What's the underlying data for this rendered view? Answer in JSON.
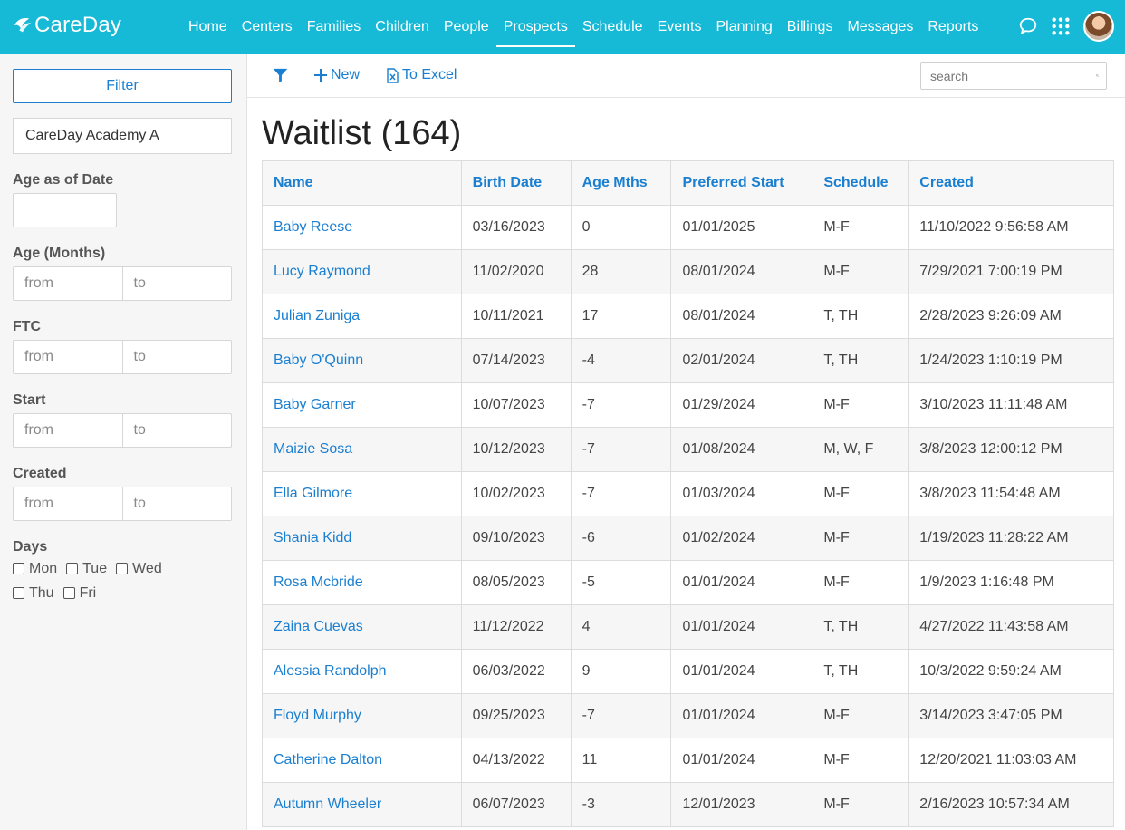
{
  "brand": "CareDay",
  "nav": [
    "Home",
    "Centers",
    "Families",
    "Children",
    "People",
    "Prospects",
    "Schedule",
    "Events",
    "Planning",
    "Billings",
    "Messages",
    "Reports"
  ],
  "nav_active": "Prospects",
  "sidebar": {
    "filter_label": "Filter",
    "center": "CareDay Academy A",
    "age_as_of_date_label": "Age as of Date",
    "age_months_label": "Age (Months)",
    "ftc_label": "FTC",
    "start_label": "Start",
    "created_label": "Created",
    "from_placeholder": "from",
    "to_placeholder": "to",
    "days_label": "Days",
    "days": [
      "Mon",
      "Tue",
      "Wed",
      "Thu",
      "Fri"
    ]
  },
  "toolbar": {
    "new_label": "New",
    "excel_label": "To Excel",
    "search_placeholder": "search"
  },
  "title": "Waitlist (164)",
  "table": {
    "headers": [
      "Name",
      "Birth Date",
      "Age Mths",
      "Preferred Start",
      "Schedule",
      "Created"
    ],
    "rows": [
      [
        "Baby Reese",
        "03/16/2023",
        "0",
        "01/01/2025",
        "M-F",
        "11/10/2022 9:56:58 AM"
      ],
      [
        "Lucy Raymond",
        "11/02/2020",
        "28",
        "08/01/2024",
        "M-F",
        "7/29/2021 7:00:19 PM"
      ],
      [
        "Julian Zuniga",
        "10/11/2021",
        "17",
        "08/01/2024",
        "T, TH",
        "2/28/2023 9:26:09 AM"
      ],
      [
        "Baby O'Quinn",
        "07/14/2023",
        "-4",
        "02/01/2024",
        "T, TH",
        "1/24/2023 1:10:19 PM"
      ],
      [
        "Baby Garner",
        "10/07/2023",
        "-7",
        "01/29/2024",
        "M-F",
        "3/10/2023 11:11:48 AM"
      ],
      [
        "Maizie Sosa",
        "10/12/2023",
        "-7",
        "01/08/2024",
        "M, W, F",
        "3/8/2023 12:00:12 PM"
      ],
      [
        "Ella Gilmore",
        "10/02/2023",
        "-7",
        "01/03/2024",
        "M-F",
        "3/8/2023 11:54:48 AM"
      ],
      [
        "Shania Kidd",
        "09/10/2023",
        "-6",
        "01/02/2024",
        "M-F",
        "1/19/2023 11:28:22 AM"
      ],
      [
        "Rosa Mcbride",
        "08/05/2023",
        "-5",
        "01/01/2024",
        "M-F",
        "1/9/2023 1:16:48 PM"
      ],
      [
        "Zaina Cuevas",
        "11/12/2022",
        "4",
        "01/01/2024",
        "T, TH",
        "4/27/2022 11:43:58 AM"
      ],
      [
        "Alessia Randolph",
        "06/03/2022",
        "9",
        "01/01/2024",
        "T, TH",
        "10/3/2022 9:59:24 AM"
      ],
      [
        "Floyd Murphy",
        "09/25/2023",
        "-7",
        "01/01/2024",
        "M-F",
        "3/14/2023 3:47:05 PM"
      ],
      [
        "Catherine Dalton",
        "04/13/2022",
        "11",
        "01/01/2024",
        "M-F",
        "12/20/2021 11:03:03 AM"
      ],
      [
        "Autumn Wheeler",
        "06/07/2023",
        "-3",
        "12/01/2023",
        "M-F",
        "2/16/2023 10:57:34 AM"
      ]
    ]
  },
  "colors": {
    "topbar": "#16b9d6",
    "link": "#1a7fd0",
    "sidebar_bg": "#f6f6f6"
  },
  "icons": {
    "logo": "leaf-logo-icon",
    "filter": "funnel-icon",
    "new": "plus-icon",
    "excel": "excel-file-icon",
    "search": "magnifier-icon",
    "chat": "chat-bubble-icon",
    "apps": "grid-apps-icon"
  }
}
